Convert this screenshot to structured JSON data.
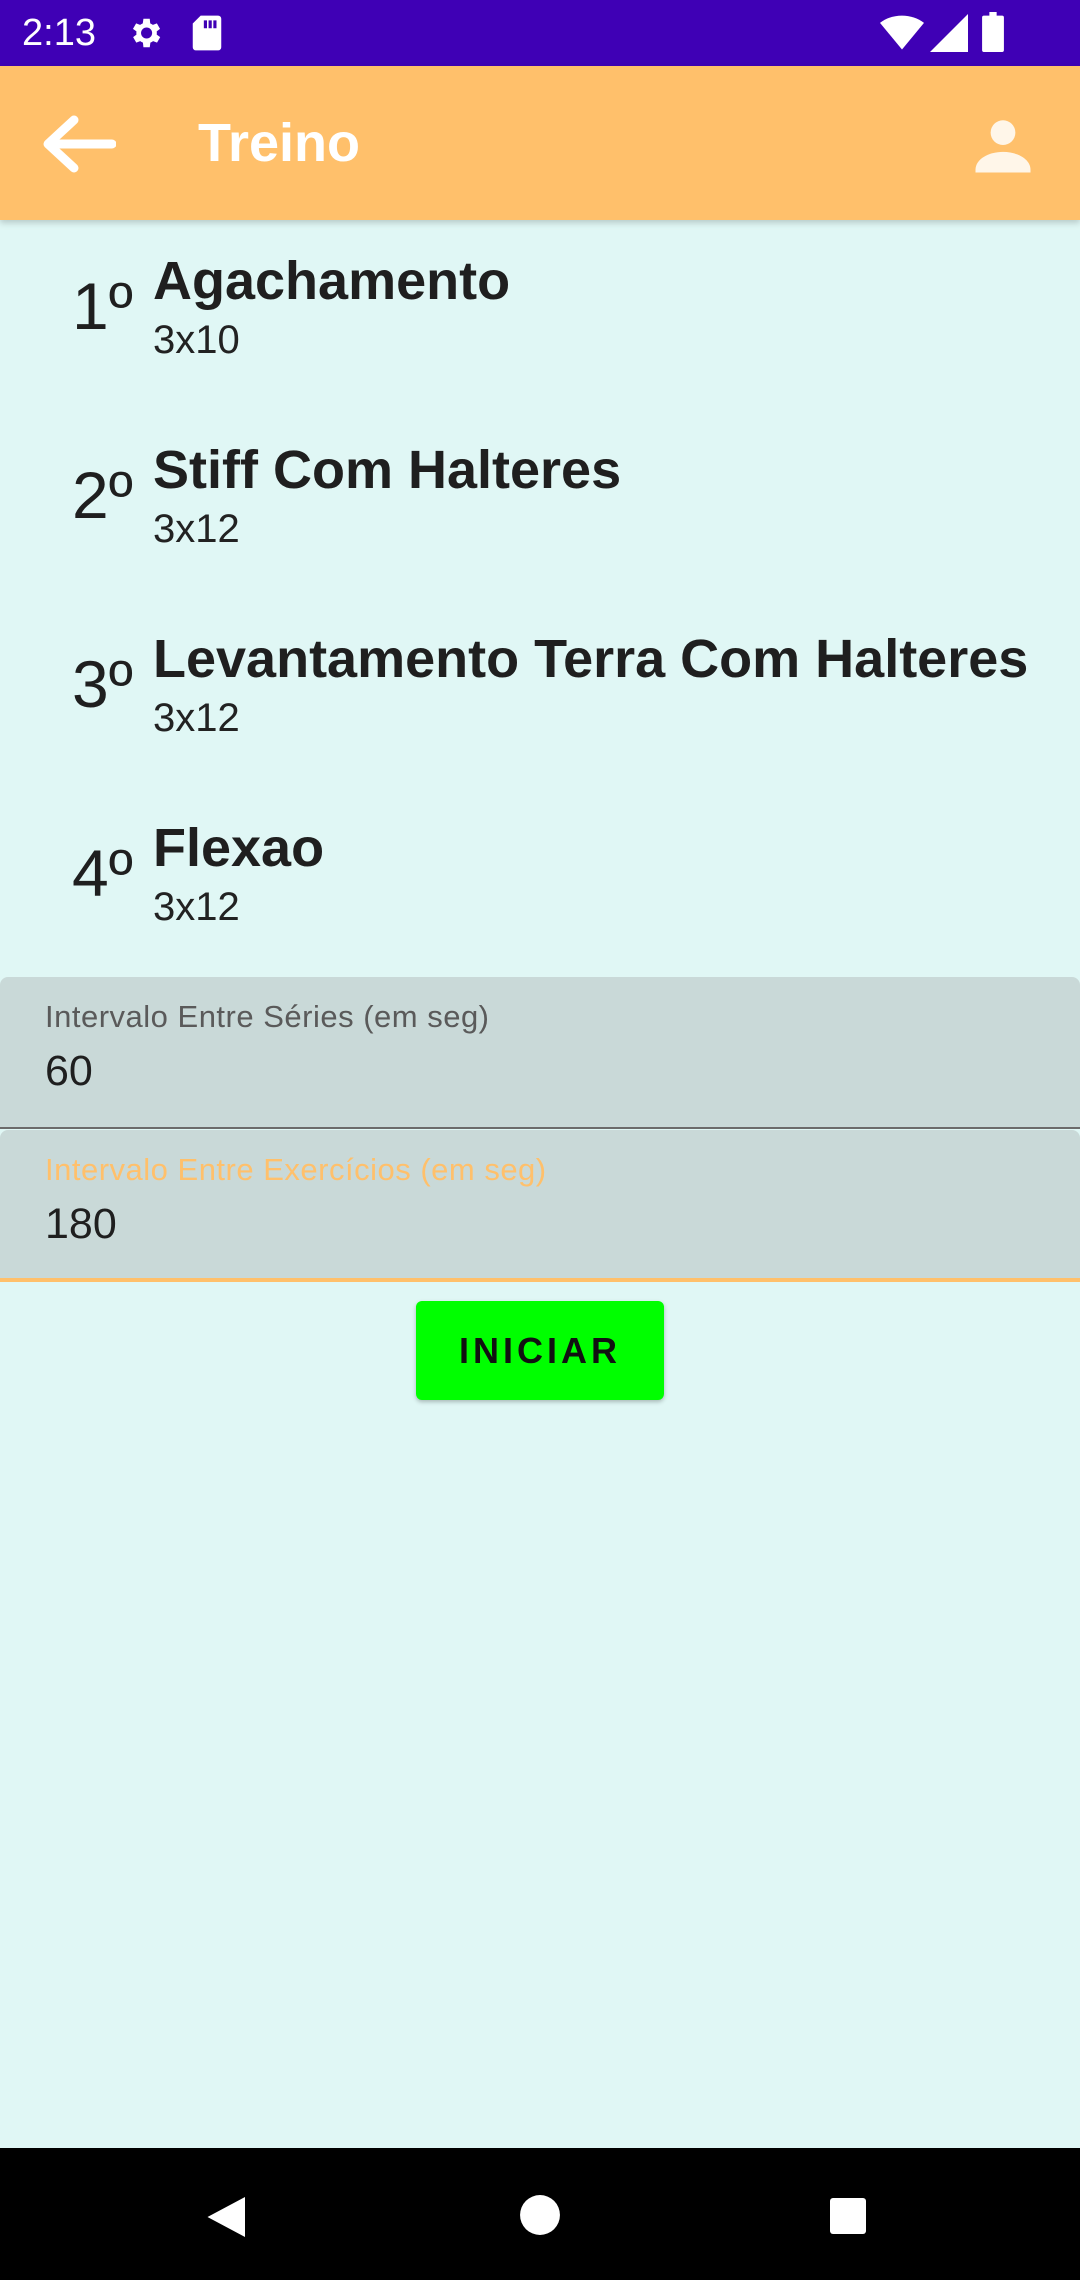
{
  "status_bar": {
    "time": "2:13",
    "icons": [
      "settings-icon",
      "sd-card-icon",
      "wifi-icon",
      "signal-icon",
      "battery-icon"
    ],
    "background": "#3F00B5"
  },
  "toolbar": {
    "title": "Treino",
    "back_icon": "arrow-back-icon",
    "profile_icon": "person-icon",
    "background": "#FFC06B"
  },
  "exercises": [
    {
      "order": "1º",
      "name": "Agachamento",
      "sets": "3x10"
    },
    {
      "order": "2º",
      "name": "Stiff Com Halteres",
      "sets": "3x12"
    },
    {
      "order": "3º",
      "name": "Levantamento Terra Com Halteres",
      "sets": "3x12"
    },
    {
      "order": "4º",
      "name": "Flexao",
      "sets": "3x12"
    }
  ],
  "fields": {
    "series_interval": {
      "label": "Intervalo Entre Séries (em seg)",
      "value": "60"
    },
    "exercise_interval": {
      "label": "Intervalo Entre Exercícios (em seg)",
      "value": "180",
      "focused": true
    }
  },
  "start_button": {
    "label": "INICIAR",
    "color": "#00FF00"
  },
  "colors": {
    "background": "#E0F7F5",
    "accent": "#FFC06B",
    "field_background": "#C9D9D8"
  },
  "nav_bar": {
    "icons": [
      "back-triangle-icon",
      "home-circle-icon",
      "recents-square-icon"
    ]
  }
}
